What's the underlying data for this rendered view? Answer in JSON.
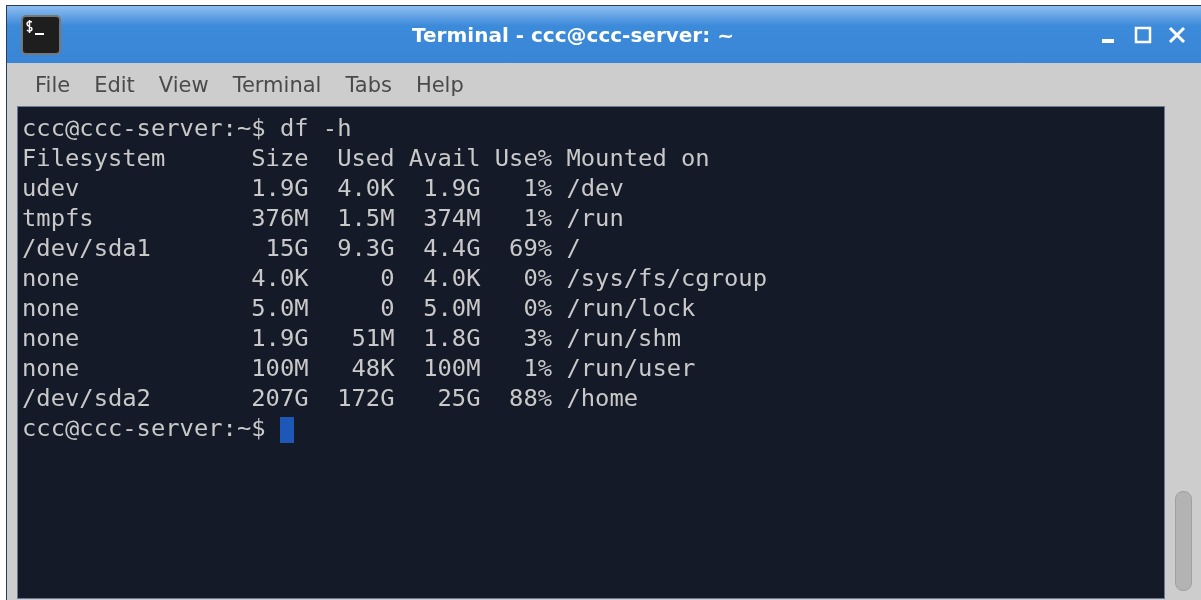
{
  "window": {
    "title": "Terminal - ccc@ccc-server: ~"
  },
  "menu": [
    "File",
    "Edit",
    "View",
    "Terminal",
    "Tabs",
    "Help"
  ],
  "terminal": {
    "lines": [
      "ccc@ccc-server:~$ df -h",
      "Filesystem      Size  Used Avail Use% Mounted on",
      "udev            1.9G  4.0K  1.9G   1% /dev",
      "tmpfs           376M  1.5M  374M   1% /run",
      "/dev/sda1        15G  9.3G  4.4G  69% /",
      "none            4.0K     0  4.0K   0% /sys/fs/cgroup",
      "none            5.0M     0  5.0M   0% /run/lock",
      "none            1.9G   51M  1.8G   3% /run/shm",
      "none            100M   48K  100M   1% /run/user",
      "/dev/sda2       207G  172G   25G  88% /home"
    ],
    "prompt": {
      "text": "ccc@ccc-server:~$ ",
      "cursor": true
    }
  }
}
